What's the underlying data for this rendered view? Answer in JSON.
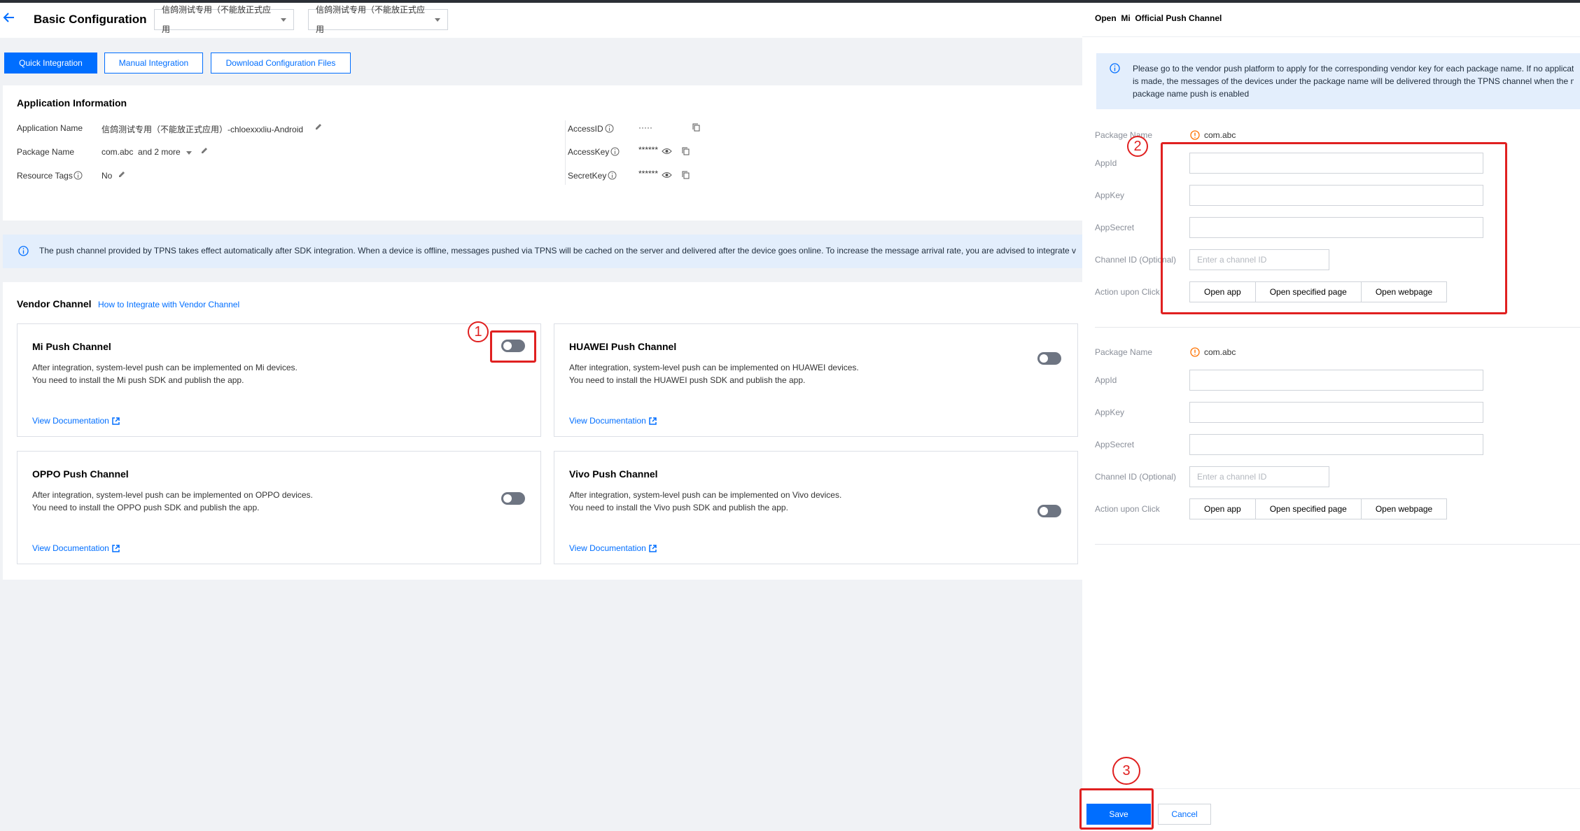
{
  "header": {
    "title": "Basic Configuration",
    "dropdown1": "信鸽测试专用（不能放正式应用",
    "dropdown2": "信鸽测试专用（不能放正式应用"
  },
  "tabs": [
    "Quick Integration",
    "Manual Integration",
    "Download Configuration Files"
  ],
  "app_info": {
    "title": "Application Information",
    "app_name_label": "Application Name",
    "app_name_value": "信鸽测试专用（不能放正式应用）-chloexxxliu-Android",
    "package_label": "Package Name",
    "package_value": "com.abc  and 2 more",
    "tags_label": "Resource Tags",
    "tags_value": "No",
    "access_id_label": "AccessID",
    "access_id_value": "·····",
    "access_key_label": "AccessKey",
    "access_key_value": "******",
    "secret_key_label": "SecretKey",
    "secret_key_value": "******"
  },
  "notice": "The push channel provided by TPNS takes effect automatically after SDK integration. When a device is offline, messages pushed via TPNS will be cached on the server and delivered after the device goes online. To increase the message arrival rate, you are advised to integrate v",
  "vendor": {
    "title": "Vendor Channel",
    "link": "How to Integrate with Vendor Channel",
    "cards": [
      {
        "title": "Mi Push Channel",
        "line1": "After integration, system-level push can be implemented on Mi devices.",
        "line2": "You need to install the Mi push SDK and publish the app.",
        "doc": "View Documentation"
      },
      {
        "title": "HUAWEI Push Channel",
        "line1": "After integration, system-level push can be implemented on HUAWEI devices.",
        "line2": "You need to install the HUAWEI push SDK and publish the app.",
        "doc": "View Documentation"
      },
      {
        "title": "OPPO Push Channel",
        "line1": "After integration, system-level push can be implemented on OPPO devices.",
        "line2": "You need to install the OPPO push SDK and publish the app.",
        "doc": "View Documentation"
      },
      {
        "title": "Vivo Push Channel",
        "line1": "After integration, system-level push can be implemented on Vivo devices.",
        "line2": "You need to install the Vivo push SDK and publish the app.",
        "doc": "View Documentation"
      }
    ]
  },
  "drawer": {
    "title": "Open  Mi  Official Push Channel",
    "info_line1": "Please go to the vendor push platform to apply for the corresponding vendor key for each package name. If no applicat",
    "info_line2": "is made, the messages of the devices under the package name will be delivered through the TPNS channel when the m",
    "info_line3": "package name push is enabled",
    "forms": [
      {
        "package_label": "Package Name",
        "package_value": "com.abc",
        "appid_label": "AppId",
        "appkey_label": "AppKey",
        "appsecret_label": "AppSecret",
        "channel_label": "Channel ID (Optional)",
        "channel_placeholder": "Enter a channel ID",
        "action_label": "Action upon Click",
        "actions": [
          "Open app",
          "Open specified page",
          "Open webpage"
        ]
      },
      {
        "package_label": "Package Name",
        "package_value": "com.abc",
        "appid_label": "AppId",
        "appkey_label": "AppKey",
        "appsecret_label": "AppSecret",
        "channel_label": "Channel ID (Optional)",
        "channel_placeholder": "Enter a channel ID",
        "action_label": "Action upon Click",
        "actions": [
          "Open app",
          "Open specified page",
          "Open webpage"
        ]
      }
    ],
    "save": "Save",
    "cancel": "Cancel"
  },
  "annotations": {
    "n1": "1",
    "n2": "2",
    "n3": "3"
  },
  "colors": {
    "primary": "#006eff",
    "annotation": "#e02020",
    "info_bg": "#e3eefc",
    "warn": "#ff7200"
  }
}
